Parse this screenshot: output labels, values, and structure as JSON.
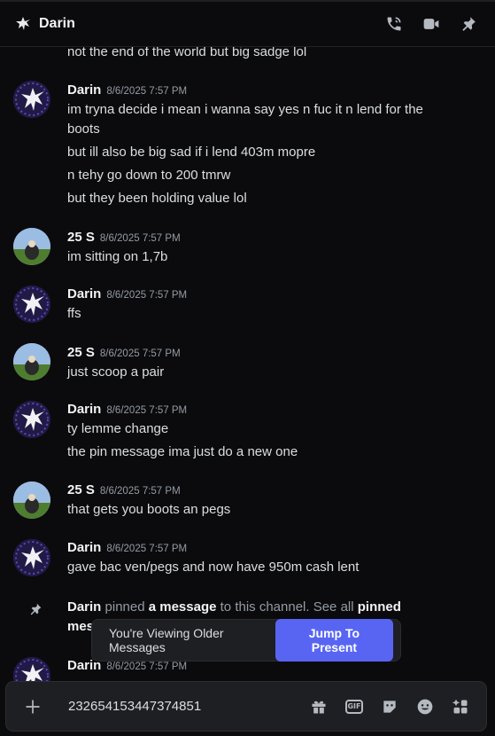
{
  "header": {
    "title": "Darin",
    "icons": [
      "phone-call-icon",
      "video-camera-icon",
      "pin-icon"
    ]
  },
  "messages": {
    "m0": {
      "text": "not the end of the world but big sadge lol"
    },
    "m1": {
      "author": "Darin",
      "timestamp": "8/6/2025 7:57 PM",
      "lines": [
        "im tryna decide i mean i wanna say yes n fuc it n lend for the",
        "boots",
        "but ill also be big sad if i lend 403m mopre",
        "n tehy go down to 200 tmrw",
        "but they been holding value lol"
      ]
    },
    "m2": {
      "author": "25 S",
      "timestamp": "8/6/2025 7:57 PM",
      "lines": [
        "im sitting on 1,7b"
      ]
    },
    "m3": {
      "author": "Darin",
      "timestamp": "8/6/2025 7:57 PM",
      "lines": [
        "ffs"
      ]
    },
    "m4": {
      "author": "25 S",
      "timestamp": "8/6/2025 7:57 PM",
      "lines": [
        "just scoop a pair"
      ]
    },
    "m5": {
      "author": "Darin",
      "timestamp": "8/6/2025 7:57 PM",
      "lines": [
        "ty lemme change",
        "the pin message ima just do a new one"
      ]
    },
    "m6": {
      "author": "25 S",
      "timestamp": "8/6/2025 7:57 PM",
      "lines": [
        "that gets you boots an pegs"
      ]
    },
    "m7": {
      "author": "Darin",
      "timestamp": "8/6/2025 7:57 PM",
      "lines": [
        "gave bac ven/pegs and now have 950m cash lent"
      ]
    },
    "pin": {
      "author": "Darin",
      "t1": "pinned",
      "link1": "a message",
      "t2": "to this channel. See all",
      "link2": "pinned",
      "t3": "mes"
    },
    "m8": {
      "author": "Darin",
      "timestamp": "8/6/2025 7:57 PM"
    }
  },
  "toast": {
    "text": "You're Viewing Older Messages",
    "button": "Jump To Present"
  },
  "composer": {
    "value": "232654153447374851",
    "tools": [
      "gift-icon",
      "gif-icon",
      "sticker-icon",
      "emoji-icon",
      "apps-icon"
    ],
    "gif_label": "GIF"
  },
  "colors": {
    "accent": "#5865f2",
    "background": "#0b0b0d",
    "timestamp": "#949ba4"
  }
}
